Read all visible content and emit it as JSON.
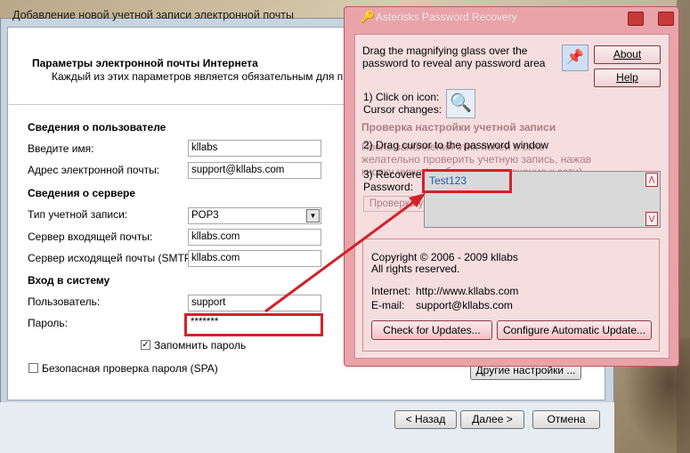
{
  "outlook": {
    "title": "Добавление новой учетной записи электронной почты",
    "header_title": "Параметры электронной почты Интернета",
    "header_subtitle": "Каждый из этих параметров является обязательным для правильной работы учетной записи электронной",
    "user_section": "Сведения о пользователе",
    "name_label": "Введите имя:",
    "name_value": "kllabs",
    "email_label": "Адрес электронной почты:",
    "email_value": "support@kllabs.com",
    "server_section": "Сведения о сервере",
    "account_type_label": "Тип учетной записи:",
    "account_type_value": "POP3",
    "incoming_label": "Сервер входящей почты:",
    "incoming_value": "kllabs.com",
    "outgoing_label": "Сервер исходящей почты (SMTP):",
    "outgoing_value": "kllabs.com",
    "login_section": "Вход в систему",
    "user_label": "Пользователь:",
    "user_value": "support",
    "password_label": "Пароль:",
    "password_value": "*******",
    "remember_label": "Запомнить пароль",
    "remember_checked": true,
    "spa_label": "Безопасная проверка пароля (SPA)",
    "spa_checked": false,
    "other_settings_button": "Другие настройки ...",
    "back_button": "< Назад",
    "next_button": "Далее >",
    "cancel_button": "Отмена",
    "ghost_right_1": "Проверка настройки учетной записи",
    "ghost_right_2": "После заполнения этих полей в окне",
    "ghost_right_3": "желательно проверить учетную запись, нажав",
    "ghost_right_4": "кнопку ниже (требуется подключение к сети)",
    "ghost_right_5": "Проверка учетной записи..."
  },
  "asterisk": {
    "title": "Asterisks Password Recovery",
    "intro": "Drag the magnifying glass over the password to reveal any password area",
    "about_button": "About",
    "help_button": "Help",
    "step1": "1) Click on icon:",
    "step1b": "Cursor changes:",
    "step2": "2) Drag cursor to the password window",
    "step3": "3) Recovered",
    "step3b": "Password:",
    "recovered_password": "Test123",
    "copyright": "Copyright © 2006 - 2009 kllabs",
    "rights": "All rights reserved.",
    "internet_label": "Internet:",
    "internet_value": "http://www.kllabs.com",
    "email_label": "E-mail:",
    "email_value": "support@kllabs.com",
    "check_updates_button": "Check for Updates...",
    "configure_update_button": "Configure Automatic Update..."
  },
  "colors": {
    "highlight_red": "#d2222a",
    "asterisk_bg": "#e9a3a9",
    "password_link": "#1a5fb4"
  },
  "icons": [
    "pin-icon",
    "magnifier-icon",
    "key-icon",
    "scroll-up-icon",
    "scroll-down-icon",
    "dropdown-arrow-icon",
    "checkmark-icon",
    "minimize-icon",
    "close-icon"
  ]
}
